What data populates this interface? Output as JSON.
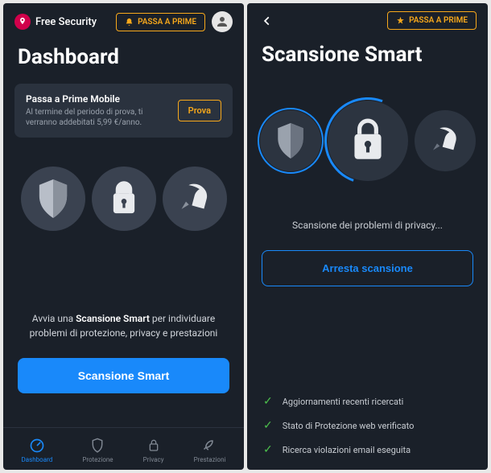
{
  "left": {
    "logo_text": "Free Security",
    "prime_label": "PASSA A PRIME",
    "title": "Dashboard",
    "promo": {
      "title": "Passa a Prime Mobile",
      "subtitle": "Al termine del periodo di prova, ti verranno addebitati 5,99 €/anno.",
      "button": "Prova"
    },
    "scan_prefix": "Avvia una ",
    "scan_bold": "Scansione Smart",
    "scan_suffix": " per individuare problemi di protezione, privacy e prestazioni",
    "scan_button": "Scansione Smart",
    "nav": [
      {
        "label": "Dashboard",
        "active": true
      },
      {
        "label": "Protezione",
        "active": false
      },
      {
        "label": "Privacy",
        "active": false
      },
      {
        "label": "Prestazioni",
        "active": false
      }
    ]
  },
  "right": {
    "prime_label": "PASSA A PRIME",
    "title": "Scansione Smart",
    "status": "Scansione dei problemi di privacy...",
    "stop_button": "Arresta scansione",
    "checks": [
      "Aggiornamenti recenti ricercati",
      "Stato di Protezione web verificato",
      "Ricerca violazioni email eseguita"
    ]
  }
}
